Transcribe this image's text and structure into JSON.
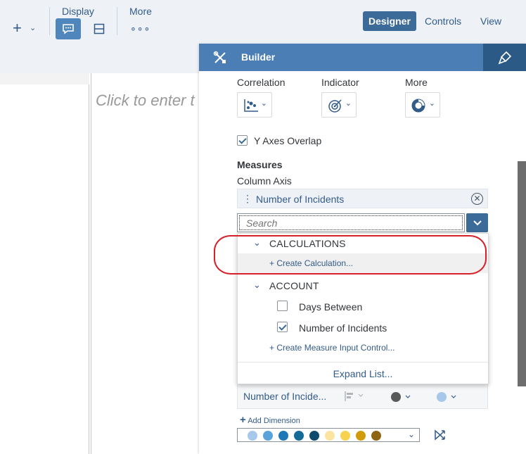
{
  "toolbar": {
    "display_label": "Display",
    "more_label": "More",
    "more_dots": "∘∘∘",
    "modes": [
      "Designer",
      "Controls",
      "View"
    ]
  },
  "canvas": {
    "placeholder_title": "Click to enter t"
  },
  "builder": {
    "title": "Builder",
    "chart_types": [
      {
        "label": "Correlation",
        "icon": "scatter-chart-icon"
      },
      {
        "label": "Indicator",
        "icon": "target-icon"
      },
      {
        "label": "More",
        "icon": "donut-chart-icon"
      }
    ],
    "y_axes_overlap": {
      "label": "Y Axes Overlap",
      "checked": true
    },
    "measures_title": "Measures",
    "column_axis_label": "Column Axis",
    "measure_chip": "Number of Incidents",
    "search_placeholder": "Search",
    "dropdown": {
      "groups": [
        {
          "label": "CALCULATIONS",
          "expanded": true,
          "link": "+ Create Calculation..."
        },
        {
          "label": "ACCOUNT",
          "expanded": true,
          "items": [
            {
              "label": "Days Between",
              "checked": false
            },
            {
              "label": "Number of Incidents",
              "checked": true
            }
          ],
          "link": "+ Create Measure Input Control..."
        }
      ],
      "expand_list": "Expand List..."
    },
    "lower_row_name": "Number of Incide...",
    "add_dimension": "Add Dimension",
    "palette": [
      "#a6c8ea",
      "#5aa3da",
      "#1d78b5",
      "#136b96",
      "#0d4a6b",
      "#fbe3a0",
      "#f6d24f",
      "#d19b0a",
      "#8c6414"
    ]
  },
  "colors": {
    "accent": "#3c6b99",
    "header": "#4a7eb5",
    "highlight": "#d6202a"
  }
}
